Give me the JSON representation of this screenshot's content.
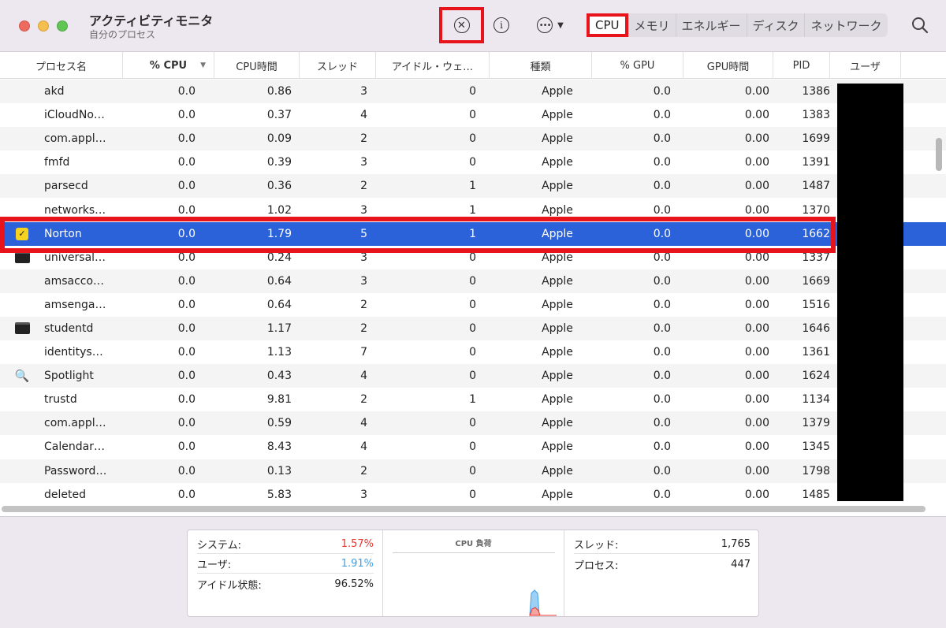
{
  "window": {
    "title": "アクティビティモニタ",
    "subtitle": "自分のプロセス"
  },
  "toolbar": {
    "stop_icon": "x-circle-icon",
    "info_icon": "info-icon",
    "more_icon": "ellipsis-circle-icon",
    "search_icon": "magnifier-icon",
    "tabs": [
      "CPU",
      "メモリ",
      "エネルギー",
      "ディスク",
      "ネットワーク"
    ],
    "active_tab": "CPU"
  },
  "columns": [
    "プロセス名",
    "% CPU",
    "CPU時間",
    "スレッド",
    "アイドル・ウェ…",
    "種類",
    "% GPU",
    "GPU時間",
    "PID",
    "ユーザ"
  ],
  "sorted_column": "% CPU",
  "rows": [
    {
      "icon": "",
      "name": "akd",
      "cpu": "0.0",
      "cpu_time": "0.86",
      "threads": "3",
      "idle": "0",
      "kind": "Apple",
      "gpu": "0.0",
      "gpu_time": "0.00",
      "pid": "1386"
    },
    {
      "icon": "",
      "name": "iCloudNo…",
      "cpu": "0.0",
      "cpu_time": "0.37",
      "threads": "4",
      "idle": "0",
      "kind": "Apple",
      "gpu": "0.0",
      "gpu_time": "0.00",
      "pid": "1383"
    },
    {
      "icon": "",
      "name": "com.appl…",
      "cpu": "0.0",
      "cpu_time": "0.09",
      "threads": "2",
      "idle": "0",
      "kind": "Apple",
      "gpu": "0.0",
      "gpu_time": "0.00",
      "pid": "1699"
    },
    {
      "icon": "",
      "name": "fmfd",
      "cpu": "0.0",
      "cpu_time": "0.39",
      "threads": "3",
      "idle": "0",
      "kind": "Apple",
      "gpu": "0.0",
      "gpu_time": "0.00",
      "pid": "1391"
    },
    {
      "icon": "",
      "name": "parsecd",
      "cpu": "0.0",
      "cpu_time": "0.36",
      "threads": "2",
      "idle": "1",
      "kind": "Apple",
      "gpu": "0.0",
      "gpu_time": "0.00",
      "pid": "1487"
    },
    {
      "icon": "",
      "name": "networks…",
      "cpu": "0.0",
      "cpu_time": "1.02",
      "threads": "3",
      "idle": "1",
      "kind": "Apple",
      "gpu": "0.0",
      "gpu_time": "0.00",
      "pid": "1370"
    },
    {
      "icon": "norton-icon",
      "name": "Norton",
      "cpu": "0.0",
      "cpu_time": "1.79",
      "threads": "5",
      "idle": "1",
      "kind": "Apple",
      "gpu": "0.0",
      "gpu_time": "0.00",
      "pid": "1662",
      "selected": true
    },
    {
      "icon": "terminal-icon",
      "name": "universal…",
      "cpu": "0.0",
      "cpu_time": "0.24",
      "threads": "3",
      "idle": "0",
      "kind": "Apple",
      "gpu": "0.0",
      "gpu_time": "0.00",
      "pid": "1337"
    },
    {
      "icon": "",
      "name": "amsacco…",
      "cpu": "0.0",
      "cpu_time": "0.64",
      "threads": "3",
      "idle": "0",
      "kind": "Apple",
      "gpu": "0.0",
      "gpu_time": "0.00",
      "pid": "1669"
    },
    {
      "icon": "",
      "name": "amsenga…",
      "cpu": "0.0",
      "cpu_time": "0.64",
      "threads": "2",
      "idle": "0",
      "kind": "Apple",
      "gpu": "0.0",
      "gpu_time": "0.00",
      "pid": "1516"
    },
    {
      "icon": "terminal-icon",
      "name": "studentd",
      "cpu": "0.0",
      "cpu_time": "1.17",
      "threads": "2",
      "idle": "0",
      "kind": "Apple",
      "gpu": "0.0",
      "gpu_time": "0.00",
      "pid": "1646"
    },
    {
      "icon": "",
      "name": "identitys…",
      "cpu": "0.0",
      "cpu_time": "1.13",
      "threads": "7",
      "idle": "0",
      "kind": "Apple",
      "gpu": "0.0",
      "gpu_time": "0.00",
      "pid": "1361"
    },
    {
      "icon": "spotlight-icon",
      "name": "Spotlight",
      "cpu": "0.0",
      "cpu_time": "0.43",
      "threads": "4",
      "idle": "0",
      "kind": "Apple",
      "gpu": "0.0",
      "gpu_time": "0.00",
      "pid": "1624"
    },
    {
      "icon": "",
      "name": "trustd",
      "cpu": "0.0",
      "cpu_time": "9.81",
      "threads": "2",
      "idle": "1",
      "kind": "Apple",
      "gpu": "0.0",
      "gpu_time": "0.00",
      "pid": "1134"
    },
    {
      "icon": "",
      "name": "com.appl…",
      "cpu": "0.0",
      "cpu_time": "0.59",
      "threads": "4",
      "idle": "0",
      "kind": "Apple",
      "gpu": "0.0",
      "gpu_time": "0.00",
      "pid": "1379"
    },
    {
      "icon": "",
      "name": "Calendar…",
      "cpu": "0.0",
      "cpu_time": "8.43",
      "threads": "4",
      "idle": "0",
      "kind": "Apple",
      "gpu": "0.0",
      "gpu_time": "0.00",
      "pid": "1345"
    },
    {
      "icon": "",
      "name": "Password…",
      "cpu": "0.0",
      "cpu_time": "0.13",
      "threads": "2",
      "idle": "0",
      "kind": "Apple",
      "gpu": "0.0",
      "gpu_time": "0.00",
      "pid": "1798"
    },
    {
      "icon": "",
      "name": "deleted",
      "cpu": "0.0",
      "cpu_time": "5.83",
      "threads": "3",
      "idle": "0",
      "kind": "Apple",
      "gpu": "0.0",
      "gpu_time": "0.00",
      "pid": "1485"
    }
  ],
  "stats": {
    "system_label": "システム:",
    "system_value": "1.57%",
    "system_color": "#e8332a",
    "user_label": "ユーザ:",
    "user_value": "1.91%",
    "user_color": "#3b9fe6",
    "idle_label": "アイドル状態:",
    "idle_value": "96.52%",
    "graph_title": "CPU 負荷",
    "threads_label": "スレッド:",
    "threads_value": "1,765",
    "processes_label": "プロセス:",
    "processes_value": "447"
  },
  "colors": {
    "selection": "#2b62d9",
    "highlight_box": "#e8141b"
  }
}
